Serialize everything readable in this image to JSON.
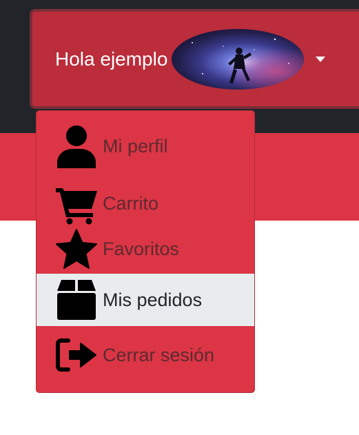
{
  "header": {
    "greeting": "Hola ejemplo",
    "avatar_alt": "astronaut-in-space-avatar"
  },
  "user_menu": {
    "items": [
      {
        "label": "Mi perfil",
        "icon": "user-icon",
        "active": false
      },
      {
        "label": "Carrito",
        "icon": "shopping-cart-icon",
        "active": false
      },
      {
        "label": "Favoritos",
        "icon": "star-icon",
        "active": false
      },
      {
        "label": "Mis pedidos",
        "icon": "box-icon",
        "active": true
      },
      {
        "label": "Cerrar sesión",
        "icon": "sign-out-icon",
        "active": false
      }
    ]
  },
  "colors": {
    "navbar_dark": "#212529",
    "brand_red": "#dc3545",
    "toggle_red": "#bb2d3b",
    "active_item_bg": "#e9ecef",
    "icon_black": "#000000"
  }
}
